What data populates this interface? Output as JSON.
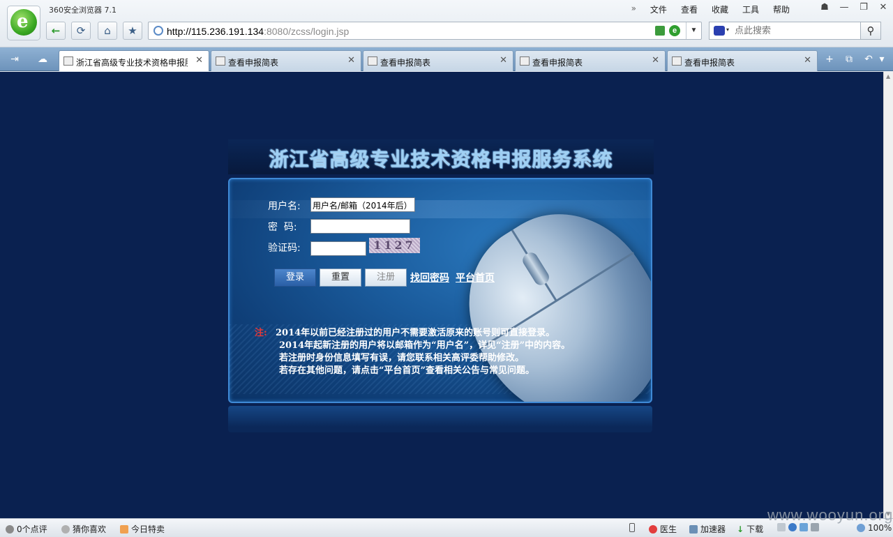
{
  "browser": {
    "app_title": "360安全浏览器 7.1",
    "menu": {
      "more": "»",
      "items": [
        "文件",
        "查看",
        "收藏",
        "工具",
        "帮助"
      ]
    },
    "window_controls": {
      "skin": "☗",
      "minimize": "—",
      "restore": "❐",
      "close": "✕"
    },
    "nav": {
      "back": "←",
      "refresh": "⟳",
      "home": "⌂",
      "favorite": "★"
    },
    "url": {
      "host": "http://115.236.191.134",
      "rest": ":8080/zcss/login.jsp"
    },
    "url_dropdown": "▼",
    "search": {
      "placeholder": "点此搜索",
      "button": "⚲",
      "engine_dropdown": "▾"
    },
    "tab_tools": {
      "sidebar": "⇥",
      "cloud": "☁",
      "new_tab": "+",
      "restore_tabs": "⧉",
      "undo": "↶",
      "more": "▾"
    },
    "tabs": [
      {
        "label": "浙江省高级专业技术资格申报服务系统",
        "close": "✕"
      },
      {
        "label": "查看申报简表",
        "close": "✕"
      },
      {
        "label": "查看申报简表",
        "close": "✕"
      },
      {
        "label": "查看申报简表",
        "close": "✕"
      },
      {
        "label": "查看申报简表",
        "close": "✕"
      }
    ],
    "scroll": {
      "up": "▲",
      "down": "▼"
    }
  },
  "page": {
    "title": "浙江省高级专业技术资格申报服务系统",
    "labels": {
      "username": "用户名:",
      "password": "密  码:",
      "captcha": "验证码:"
    },
    "username_value": "用户名/邮箱（2014年后）",
    "captcha_text": "1127",
    "buttons": {
      "login": "登录",
      "reset": "重置",
      "register": "注册"
    },
    "links": {
      "forgot": "找回密码",
      "home": "平台首页"
    },
    "note_mark": "注:",
    "notes": [
      "2014年以前已经注册过的用户不需要激活原来的账号则可直接登录。",
      "2014年起新注册的用户将以邮箱作为“用户名”，详见“注册”中的内容。",
      "若注册时身份信息填写有误，请您联系相关高评委帮助修改。",
      "若存在其他问题，请点击“平台首页”查看相关公告与常见问题。"
    ]
  },
  "statusbar": {
    "comments": "0个点评",
    "guess": "猜你喜欢",
    "deals": "今日特卖",
    "doctor": "医生",
    "accelerator": "加速器",
    "download": "下载",
    "zoom": "100%"
  },
  "watermark": "www.wooyun.org",
  "colors": {
    "page_bg": "#0a2150",
    "accent": "#3f8ad6",
    "note_mark": "#e23838"
  }
}
